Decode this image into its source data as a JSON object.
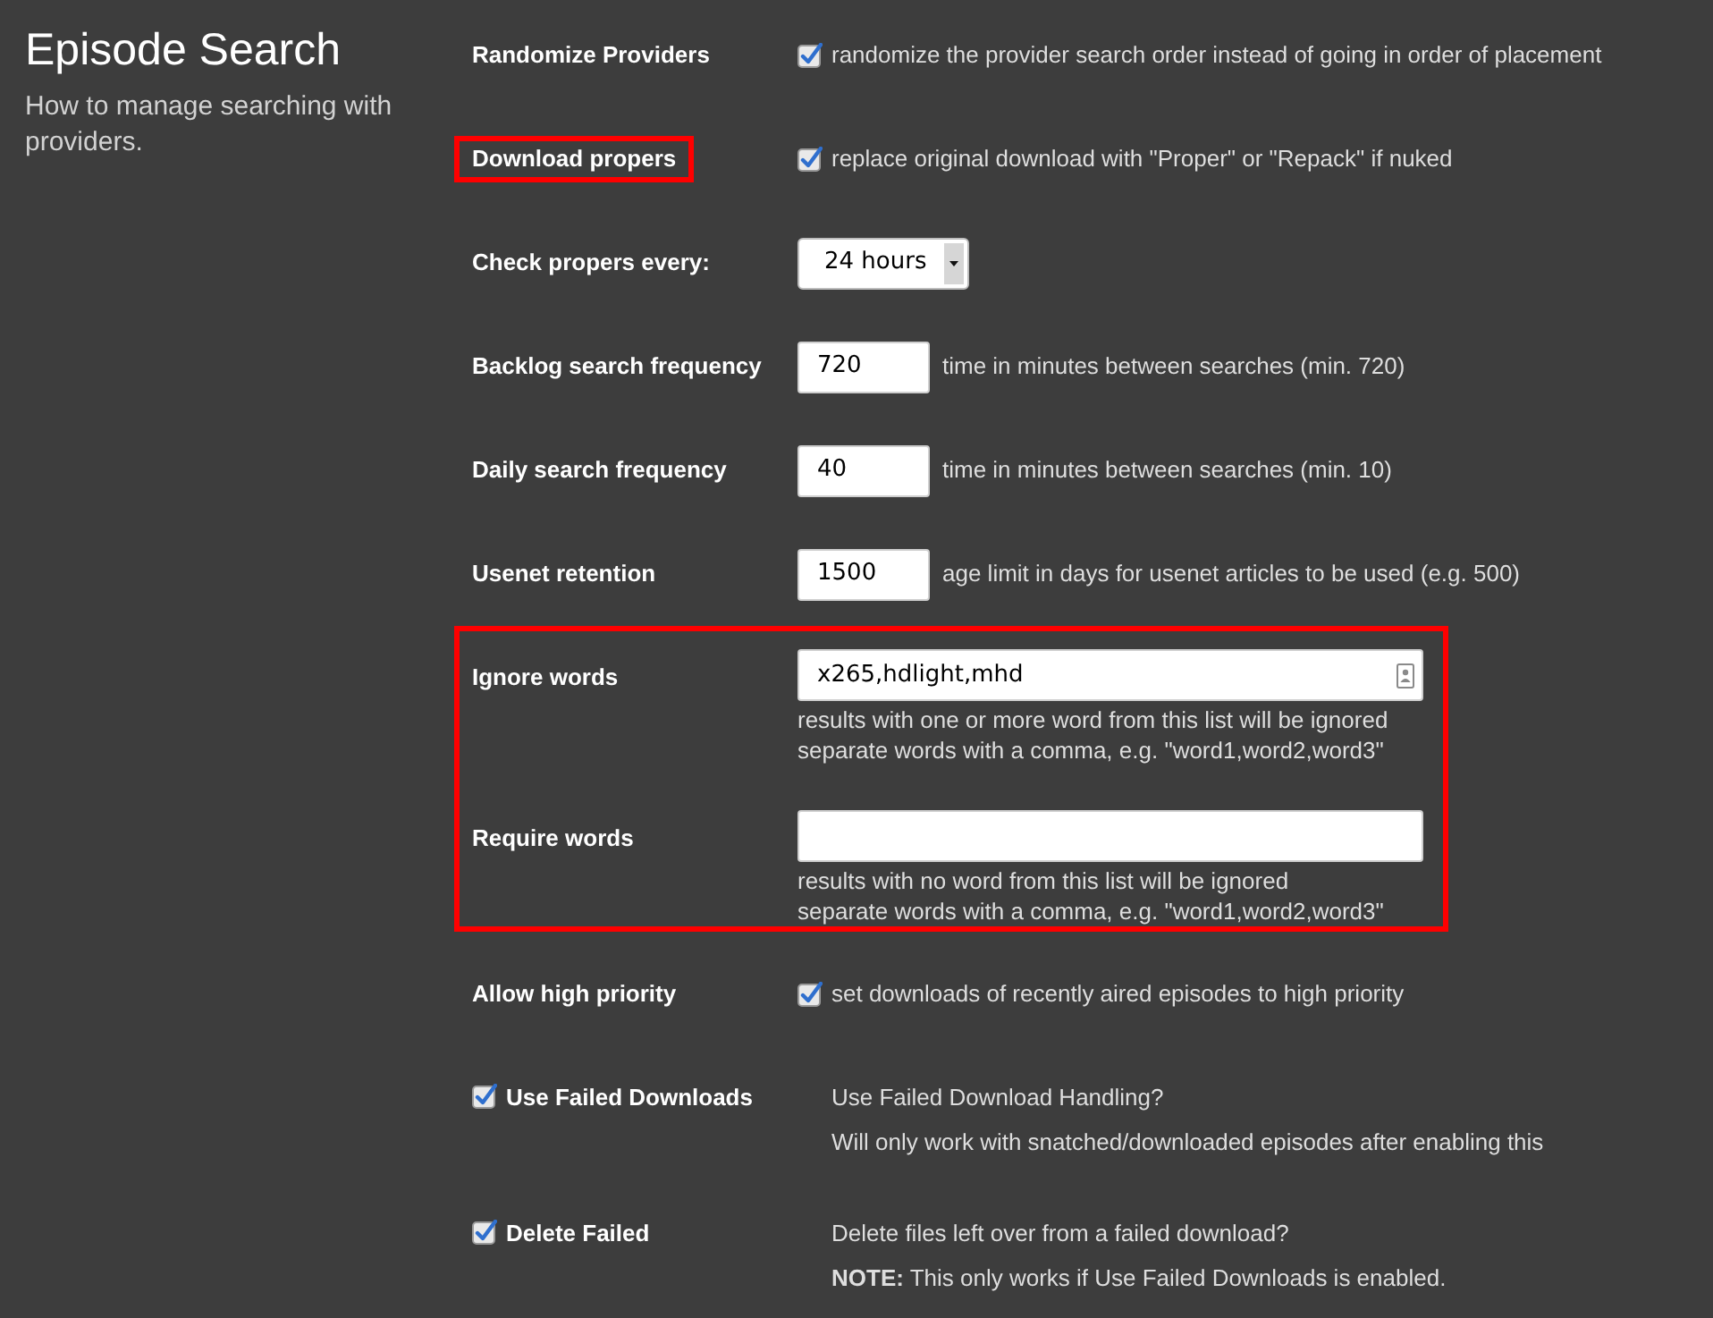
{
  "sidebar": {
    "title": "Episode Search",
    "description": "How to manage searching with providers."
  },
  "settings": [
    {
      "kind": "checkbox",
      "label": "Randomize Providers",
      "highlighted": false,
      "checked": true,
      "description": "randomize the provider search order instead of going in order of placement"
    },
    {
      "kind": "checkbox",
      "label": "Download propers",
      "highlighted": true,
      "checked": true,
      "description": "replace original download with \"Proper\" or \"Repack\" if nuked"
    },
    {
      "kind": "select",
      "label": "Check propers every:",
      "highlighted": false,
      "value": "24 hours"
    },
    {
      "kind": "number",
      "label": "Backlog search frequency",
      "highlighted": false,
      "value": "720",
      "description": "time in minutes between searches (min. 720)"
    },
    {
      "kind": "number",
      "label": "Daily search frequency",
      "highlighted": false,
      "value": "40",
      "description": "time in minutes between searches (min. 10)"
    },
    {
      "kind": "number",
      "label": "Usenet retention",
      "highlighted": false,
      "value": "1500",
      "description": "age limit in days for usenet articles to be used (e.g. 500)"
    },
    {
      "kind": "word_group",
      "highlighted": true,
      "fields": [
        {
          "label": "Ignore words",
          "value": "x265,hdlight,mhd",
          "autofill": true,
          "notes": [
            "results with one or more word from this list will be ignored",
            "separate words with a comma, e.g. \"word1,word2,word3\""
          ]
        },
        {
          "label": "Require words",
          "autofill": false,
          "notes": [
            "results with no word from this list will be ignored",
            "separate words with a comma, e.g. \"word1,word2,word3\""
          ]
        }
      ]
    },
    {
      "kind": "checkbox",
      "label": "Allow high priority",
      "highlighted": false,
      "checked": true,
      "description": "set downloads of recently aired episodes to high priority"
    },
    {
      "kind": "toggle_section",
      "label": "Use Failed Downloads",
      "checked": true,
      "notes": [
        "Use Failed Download Handling?",
        "Will only work with snatched/downloaded episodes after enabling this"
      ]
    },
    {
      "kind": "toggle_section",
      "label": "Delete Failed",
      "checked": true,
      "notes": [
        "Delete files left over from a failed download?",
        "**NOTE:** This only works if Use Failed Downloads is enabled."
      ]
    }
  ]
}
